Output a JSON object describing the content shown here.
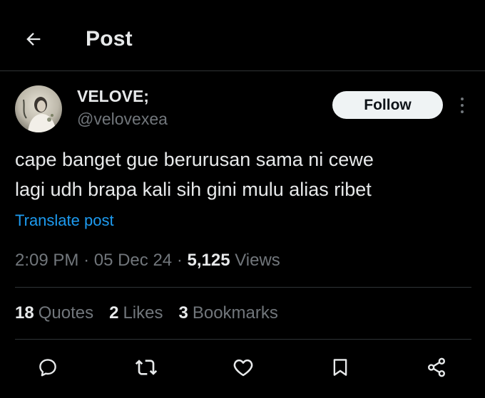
{
  "header": {
    "title": "Post",
    "back_icon": "arrow-left-icon"
  },
  "author": {
    "display_name": "VELOVE;",
    "handle": "@velovexea"
  },
  "follow_label": "Follow",
  "tweet": {
    "text": "cape banget gue berurusan sama ni cewe\nlagi udh brapa kali sih gini mulu alias ribet",
    "translate_label": "Translate post"
  },
  "meta": {
    "time": "2:09 PM",
    "date": "05 Dec 24",
    "views_count": "5,125",
    "views_label": "Views"
  },
  "stats": {
    "quotes_count": "18",
    "quotes_label": "Quotes",
    "likes_count": "2",
    "likes_label": "Likes",
    "bookmarks_count": "3",
    "bookmarks_label": "Bookmarks"
  },
  "actions": [
    "reply-icon",
    "repost-icon",
    "like-icon",
    "bookmark-icon",
    "share-icon"
  ],
  "colors": {
    "background": "#000000",
    "text": "#e7e9ea",
    "muted": "#71767b",
    "link": "#1d9bf0",
    "divider": "#2f3336",
    "follow_bg": "#eff3f4"
  }
}
